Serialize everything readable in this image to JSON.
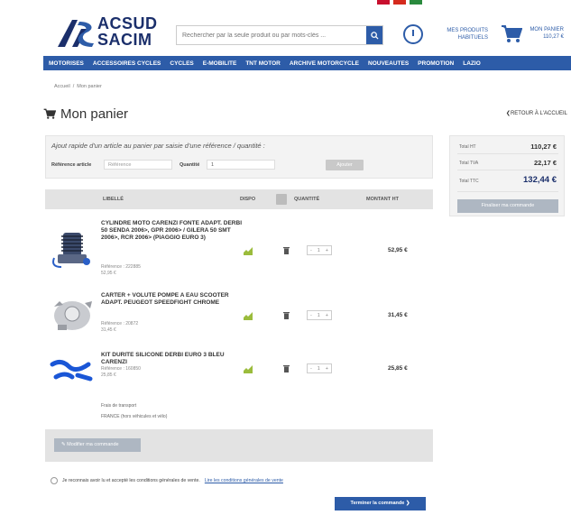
{
  "header": {
    "logo_top": "ACSUD",
    "logo_bottom": "SACIM",
    "search_placeholder": "Rechercher par la seule produit ou par mots-clés ...",
    "products_link": "MES PRODUITS HABITUELS",
    "cart_label": "MON PANIER",
    "cart_amount": "110,27 €"
  },
  "nav": [
    "MOTORISES",
    "ACCESSOIRES CYCLES",
    "CYCLES",
    "E-MOBILITE",
    "TNT MOTOR",
    "ARCHIVE MOTORCYCLE",
    "NOUVEAUTES",
    "PROMOTION",
    "LAZIO"
  ],
  "breadcrumb": {
    "home": "Accueil",
    "current": "Mon panier"
  },
  "page": {
    "title": "Mon panier",
    "back_link": "RETOUR À L'ACCUEIL"
  },
  "quick_add": {
    "title": "Ajout rapide d'un article au panier par saisie d'une référence / quantité :",
    "ref_label": "Référence article",
    "ref_placeholder": "Référence",
    "qty_label": "Quantité",
    "qty_value": "1",
    "button": "Ajouter"
  },
  "table": {
    "headers": {
      "libelle": "LIBELLÉ",
      "dispo": "DISPO",
      "quantite": "QUANTITÉ",
      "montant": "MONTANT HT"
    },
    "rows": [
      {
        "name": "CYLINDRE MOTO CARENZI FONTE ADAPT. DERBI 50 SENDA 2006>, GPR 2006> / GILERA 50 SMT 2006>, RCR 2006> (PIAGGIO EURO 3)",
        "ref": "Référence : 222885",
        "unit": "52,95 €",
        "qty": "1",
        "amount": "52,95 €"
      },
      {
        "name": "CARTER + VOLUTE POMPE A EAU SCOOTER ADAPT. PEUGEOT SPEEDFIGHT CHROME",
        "ref": "Référence : 20872",
        "unit": "31,45 €",
        "qty": "1",
        "amount": "31,45 €"
      },
      {
        "name": "KIT DURITE SILICONE DERBI EURO 3 BLEU CARENZI",
        "ref": "Référence : 160850",
        "unit": "25,85 €",
        "qty": "1",
        "amount": "25,85 €"
      }
    ],
    "shipping": [
      "Frais de transport",
      "FRANCE (hors véhicules et vélo)"
    ]
  },
  "modify_button": "Modifier ma commande",
  "cgv": {
    "text": "Je reconnais avoir lu et accepté les conditions générales de vente.",
    "link": "Lire les conditions générales de vente"
  },
  "next_button": "Terminer la commande",
  "summary": {
    "subtotal_label": "Total HT",
    "subtotal_value": "110,27 €",
    "tva_label": "Total TVA",
    "tva_value": "22,17 €",
    "total_label": "Total TTC",
    "total_value": "132,44 €",
    "button": "Finaliser ma commande"
  },
  "colors": {
    "primary": "#2d5ca8",
    "brand_dark": "#1b2f6b",
    "table_header_bg": "#e3e3e3",
    "panel_bg": "#f3f3f3",
    "disabled_button": "#aeb7c2",
    "stock_ok": "#9bbc3c"
  }
}
